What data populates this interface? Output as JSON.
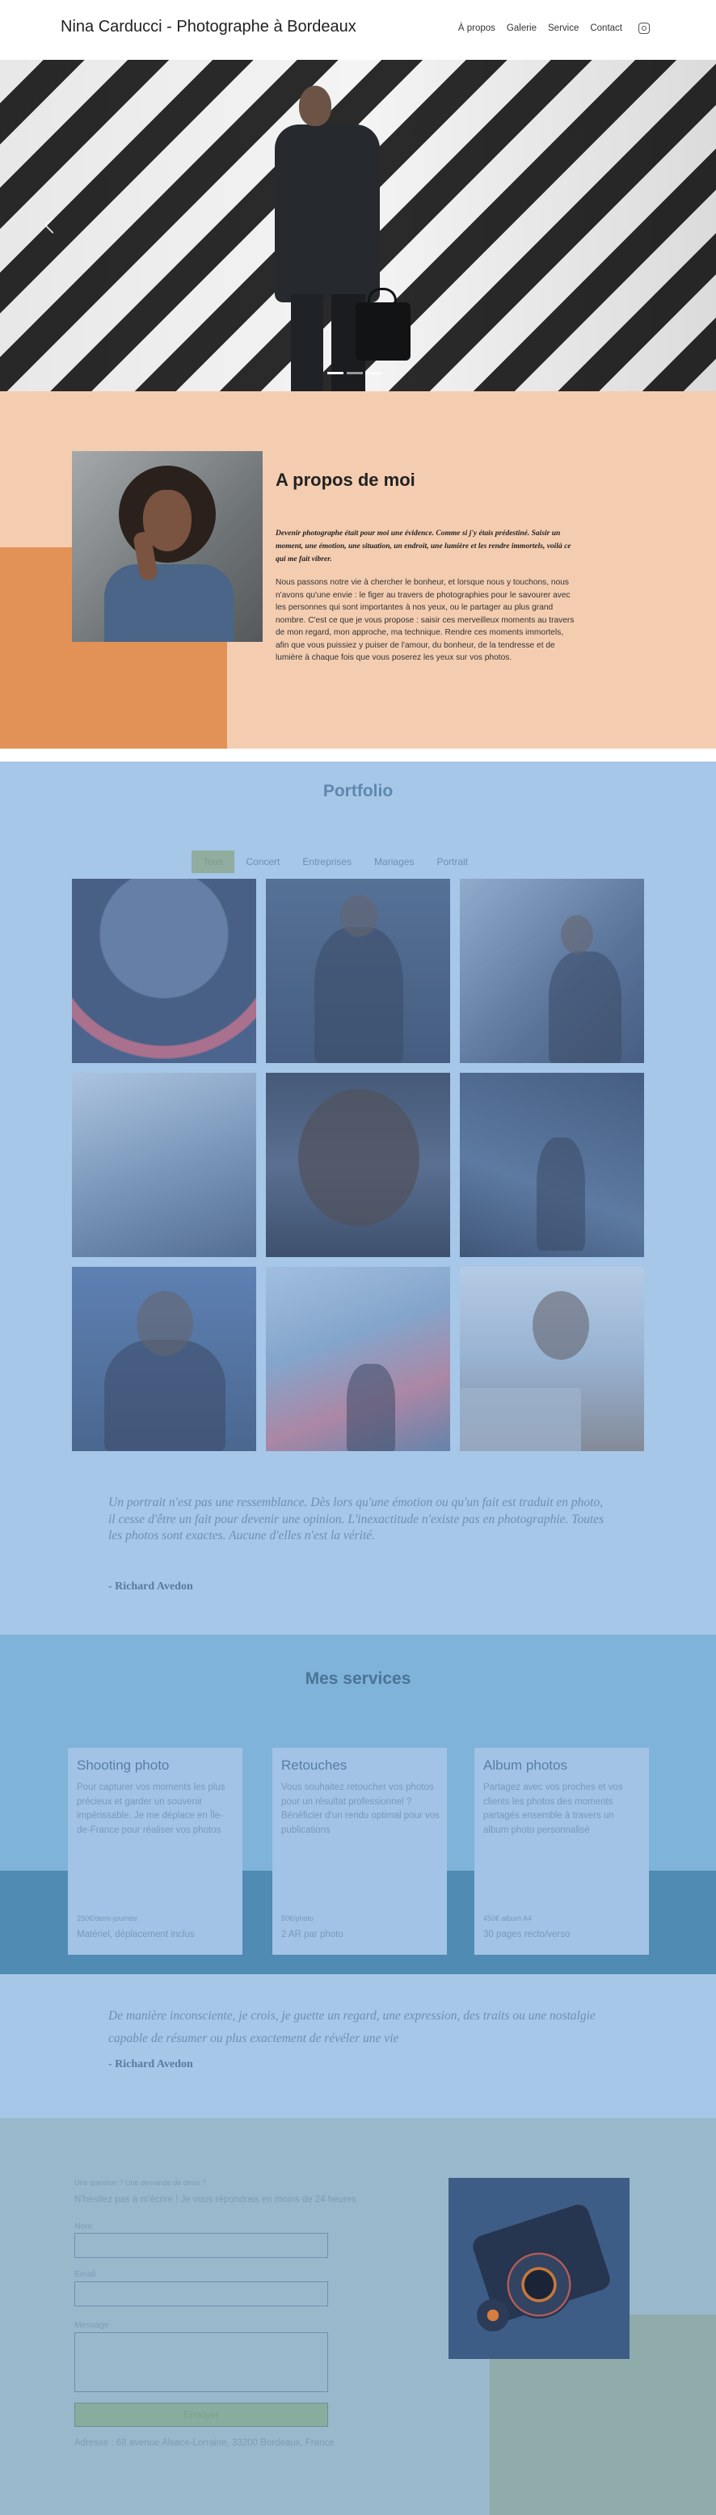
{
  "header": {
    "site_title": "Nina Carducci - Photographe à Bordeaux",
    "nav": [
      "À propos",
      "Galerie",
      "Service",
      "Contact"
    ],
    "instagram_icon": "instagram-icon"
  },
  "hero": {
    "slides_count": 3,
    "active_slide": 1
  },
  "about": {
    "title": "A propos de moi",
    "lead": "Devenir photographe était pour moi une évidence. Comme si j'y étais prédestiné. Saisir un moment, une émotion, une situation, un endroit, une lumière et les rendre immortels, voilà ce qui me fait vibrer.",
    "body": "Nous passons notre vie à chercher le bonheur, et lorsque nous y touchons, nous n'avons qu'une envie : le figer au travers de photographies pour le savourer avec les personnes qui sont importantes à nos yeux, ou le partager au plus grand nombre. C'est ce que je vous propose : saisir ces merveilleux moments au travers de mon regard, mon approche, ma technique. Rendre ces moments immortels, afin que vous puissiez y puiser de l'amour, du bonheur, de la tendresse et de lumière à chaque fois que vous poserez les yeux sur vos photos."
  },
  "portfolio": {
    "title": "Portfolio",
    "filters": [
      "Tous",
      "Concert",
      "Entreprises",
      "Mariages",
      "Portrait"
    ],
    "active_filter": "Tous",
    "quote": "Un portrait n'est pas une ressemblance. Dès lors qu'une émotion ou qu'un fait est traduit en photo, il cesse d'être un fait pour devenir une opinion. L'inexactitude n'existe pas en photographie. Toutes les photos sont exactes. Aucune d'elles n'est la vérité.",
    "quote_author": "- Richard Avedon"
  },
  "services": {
    "title": "Mes services",
    "cards": [
      {
        "title": "Shooting photo",
        "description": "Pour capturer vos moments les plus précieux et garder un souvenir impérissable. Je me déplace en Île-de-France pour réaliser vos photos",
        "price": "250€/demi-journée",
        "extra": "Matériel, déplacement inclus"
      },
      {
        "title": "Retouches",
        "description": "Vous souhaitez retoucher vos photos pour un résultat professionnel ? Bénéficier d'un rendu optimal pour vos publications",
        "price": "50€/photo",
        "extra": "2 AR par photo"
      },
      {
        "title": "Album photos",
        "description": "Partagez avec vos proches et vos clients les photos des moments partagés ensemble à travers un album photo personnalisé",
        "price": "450€ album A4",
        "extra": "30 pages recto/verso"
      }
    ],
    "quote": "De manière inconsciente, je crois, je guette un regard, une expression, des traits ou une nostalgie capable de résumer ou plus exactement de révéler une vie",
    "quote_author": "- Richard Avedon"
  },
  "contact": {
    "small": "Une question ? Une demande de devis ?",
    "lead": "N'hésitez pas à m'écrire ! Je vous répondrais en moins de 24 heures",
    "name_label": "Nom",
    "email_label": "Email",
    "message_label": "Message",
    "send_label": "Envoyer",
    "address": "Adresse : 68 avenue Alsace-Lorraine, 33200 Bordeaux, France"
  }
}
